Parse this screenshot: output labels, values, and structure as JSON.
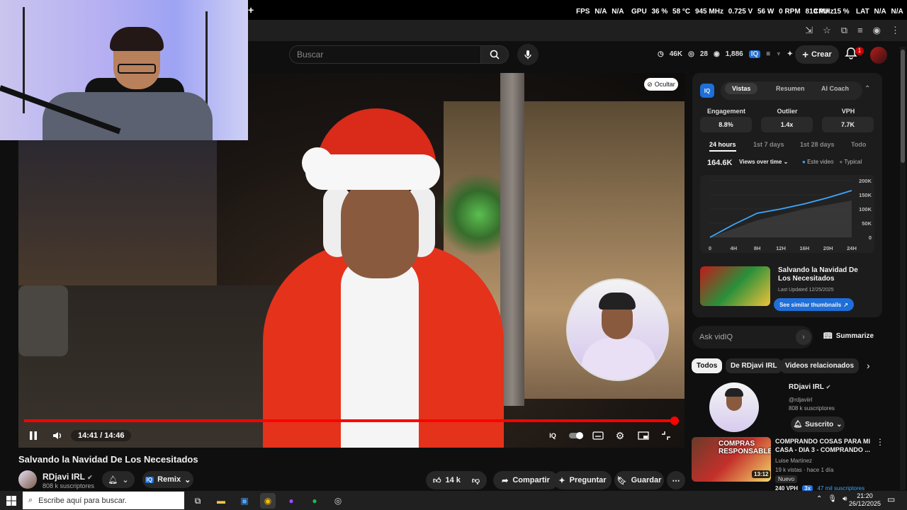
{
  "osd": {
    "fps_label": "FPS",
    "fps_1": "N/A",
    "fps_2": "N/A",
    "gpu_label": "GPU",
    "gpu_load": "36 %",
    "gpu_temp": "58 °C",
    "gpu_clock": "945 MHz",
    "gpu_volt": "0.725 V",
    "gpu_power": "56 W",
    "gpu_rpm": "0 RPM",
    "gpu_mem": "810 MHz",
    "cpu_label": "CPU",
    "cpu_load": "15 %",
    "lat_label": "LAT",
    "lat_1": "N/A",
    "lat_2": "N/A"
  },
  "header": {
    "search_placeholder": "Buscar",
    "stat_views": "46K",
    "stat_watching": "28",
    "stat_eye": "1,886",
    "create_label": "Crear",
    "notif_count": "1"
  },
  "player": {
    "hide_label": "Ocultar",
    "time": "14:41 / 14:46",
    "progress": 0.994
  },
  "video": {
    "title": "Salvando la Navidad De Los Necesitados",
    "channel": "RDjavi IRL",
    "subs": "808 k suscriptores",
    "remix": "Remix",
    "likes": "14 k",
    "share": "Compartir",
    "ask": "Preguntar",
    "save": "Guardar"
  },
  "vidiq": {
    "logo": "IQ",
    "tabs": [
      "Vistas",
      "Resumen",
      "AI Coach"
    ],
    "metrics": [
      {
        "label": "Engagement",
        "value": "8.8%"
      },
      {
        "label": "Outlier",
        "value": "1.4x"
      },
      {
        "label": "VPH",
        "value": "7.7K"
      }
    ],
    "ranges": [
      "24 hours",
      "1st 7 days",
      "1st 28 days",
      "Todo"
    ],
    "total_views": "164.6K",
    "views_select": "Views over time",
    "legend_this": "Este video",
    "legend_typical": "Typical",
    "thumb_title": "Salvando la Navidad De Los Necesitados",
    "last_updated": "Last Updated 12/25/2025",
    "similar_btn": "See similar thumbnails"
  },
  "chart_data": {
    "type": "area",
    "x": [
      "0",
      "4H",
      "8H",
      "12H",
      "16H",
      "20H",
      "24H"
    ],
    "y_ticks": [
      "0",
      "50K",
      "100K",
      "150K",
      "200K"
    ],
    "ylim": [
      0,
      200000
    ],
    "series": [
      {
        "name": "Este video",
        "values": [
          0,
          45000,
          85000,
          100000,
          118000,
          140000,
          165000
        ]
      },
      {
        "name": "Typical",
        "values": [
          0,
          30000,
          60000,
          80000,
          100000,
          115000,
          130000
        ]
      }
    ]
  },
  "sidebar": {
    "ask_placeholder": "Ask vidIQ",
    "summarize": "Summarize",
    "chips": [
      "Todos",
      "De RDjavi IRL",
      "Videos relacionados"
    ],
    "channel_name": "RDjavi IRL",
    "channel_handle": "@rdjaviirl",
    "channel_subs": "808 k suscriptores",
    "subscribed": "Suscrito",
    "rec_thumb_text": "COMPRAS",
    "rec_thumb_text2": "RESPONSABLES",
    "rec_duration": "13:12",
    "rec_title": "COMPRANDO COSAS PARA MI CASA - DIA 3 - COMPRANDO ...",
    "rec_author": "Luise Martinez",
    "rec_meta": "19 k vistas · hace 1 día",
    "rec_new": "Nuevo",
    "rec_vph": "240 VPH",
    "rec_mult": "3x",
    "rec_subs": "47 mil suscriptores"
  },
  "taskbar": {
    "search_placeholder": "Escribe aquí para buscar.",
    "time": "21:20",
    "date": "26/12/2025"
  }
}
